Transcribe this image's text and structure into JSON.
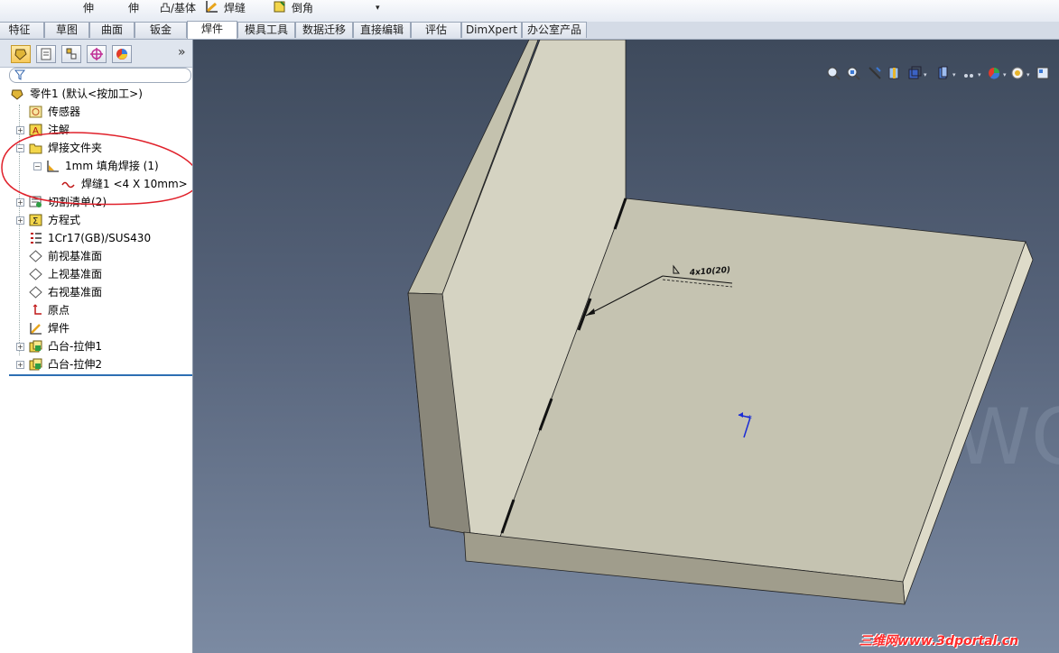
{
  "ribbon": {
    "items": [
      {
        "label": "伸"
      },
      {
        "label": "伸"
      },
      {
        "label": "凸/基体"
      },
      {
        "label": "焊缝"
      },
      {
        "label": "倒角"
      }
    ]
  },
  "tabs": [
    {
      "label": "特征"
    },
    {
      "label": "草图"
    },
    {
      "label": "曲面"
    },
    {
      "label": "钣金"
    },
    {
      "label": "焊件"
    },
    {
      "label": "模具工具"
    },
    {
      "label": "数据迁移"
    },
    {
      "label": "直接编辑"
    },
    {
      "label": "评估"
    },
    {
      "label": "DimXpert"
    },
    {
      "label": "办公室产品"
    }
  ],
  "tree": {
    "root": {
      "label": "零件1  (默认<按加工>)"
    },
    "items": [
      {
        "label": "传感器"
      },
      {
        "label": "注解"
      },
      {
        "label": "焊接文件夹"
      },
      {
        "label": "1mm 填角焊接 (1)"
      },
      {
        "label": "焊缝1 <4 X 10mm>"
      },
      {
        "label": "切割清单(2)"
      },
      {
        "label": "方程式"
      },
      {
        "label": "1Cr17(GB)/SUS430"
      },
      {
        "label": "前视基准面"
      },
      {
        "label": "上视基准面"
      },
      {
        "label": "右视基准面"
      },
      {
        "label": "原点"
      },
      {
        "label": "焊件"
      },
      {
        "label": "凸台-拉伸1"
      },
      {
        "label": "凸台-拉伸2"
      }
    ]
  },
  "viewport": {
    "weld_callout": "4x10(20)",
    "background_text": "WO"
  },
  "watermark": "三维网www.3dportal.cn",
  "colors": {
    "annotation_circle": "#e0202a",
    "selected_tab": "#ffffff",
    "plate_top": "#c9c7b3",
    "plate_side": "#8d8a7a"
  }
}
